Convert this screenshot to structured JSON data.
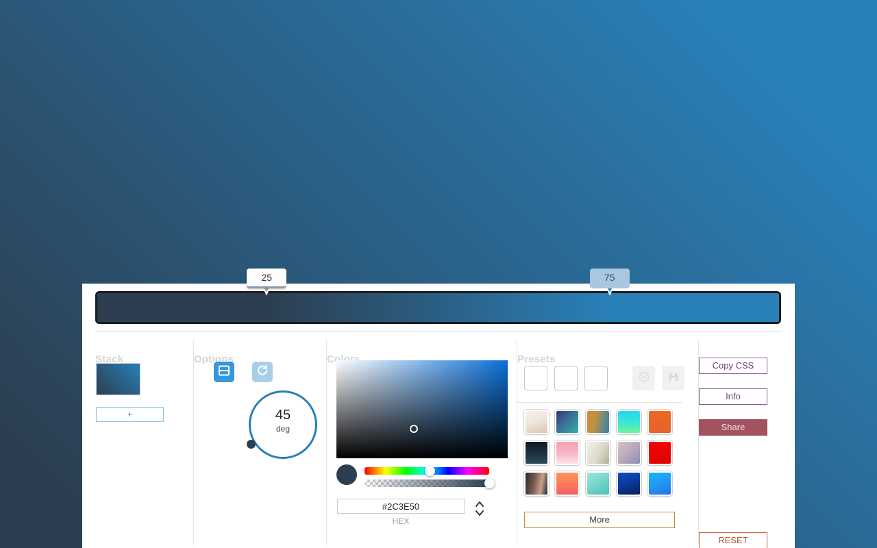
{
  "background": {
    "type": "linear-gradient",
    "angle_deg": 45,
    "from": "#2C3E50",
    "to": "#2980B9"
  },
  "preview": {
    "gradient_css": "linear-gradient(90deg, #2C3E50 25%, #2980B9 75%)",
    "stops": [
      {
        "label": "25",
        "position_pct": 25,
        "color": "#2C3E50",
        "selected": false
      },
      {
        "label": "75",
        "position_pct": 75,
        "color": "#2980B9",
        "selected": true
      }
    ]
  },
  "columns": {
    "stack": {
      "title": "Stack",
      "add_label": "+",
      "layers": [
        {
          "name": "layer-thumbnail",
          "gradient_css": "linear-gradient(45deg, #2C3E50, #2980B9)"
        }
      ]
    },
    "options": {
      "title": "Options",
      "linear_icon": "linear-gradient-icon",
      "radial_icon": "refresh-rotate-icon",
      "linear_active": true,
      "angle_value": "45",
      "angle_unit": "deg"
    },
    "colors": {
      "title": "Colors",
      "picker_color": "#0a6fd8",
      "current_swatch": "#2C3E50",
      "hue_pct": 52,
      "alpha_pct": 100,
      "hex_value": "#2C3E50",
      "hex_label": "HEX",
      "stepper_icon": "chevron-up-down-icon"
    },
    "presets": {
      "title": "Presets",
      "saved_slots": [
        "",
        "",
        ""
      ],
      "saved_actions": [
        {
          "icon": "check-circle-icon",
          "disabled": true
        },
        {
          "icon": "floppy-save-icon",
          "disabled": true
        }
      ],
      "more_label": "More",
      "swatches": [
        {
          "gradient_css": "linear-gradient(160deg, #f7f3ee 0%, #efe6dc 45%, #d8c6b6 100%)"
        },
        {
          "gradient_css": "linear-gradient(135deg, #2b3b73 0%, #3b6f96 45%, #2fb3ab 100%)"
        },
        {
          "gradient_css": "linear-gradient(100deg, #c98b3c 0%, #c2933f 35%, #2f7fb0 100%)"
        },
        {
          "gradient_css": "linear-gradient(180deg, #22d7f5 0%, #43e8ce 60%, #72f59a 100%)"
        },
        {
          "gradient_css": "linear-gradient(180deg, #ed6a24 0%, #e8622a 100%)"
        },
        {
          "gradient_css": "linear-gradient(180deg, #0d1a26 0%, #1c3140 55%, #2f4d5c 100%)"
        },
        {
          "gradient_css": "linear-gradient(180deg, #f4a0b4 0%, #f7b8c6 55%, #fde3e8 100%)"
        },
        {
          "gradient_css": "linear-gradient(120deg, #f2f0ea 0%, #ddd9cc 55%, #b3ae97 100%)"
        },
        {
          "gradient_css": "linear-gradient(135deg, #d8c2bc 0%, #b8a9bd 50%, #8d8bb5 100%)"
        },
        {
          "gradient_css": "linear-gradient(180deg, #f00505 0%, #e00303 100%)"
        },
        {
          "gradient_css": "linear-gradient(100deg, #2b2b2b 0%, #7a5a50 40%, #c9a08a 70%, #1b2a38 100%)"
        },
        {
          "gradient_css": "linear-gradient(180deg, #ff9358 0%, #fb7a5c 55%, #f4615f 100%)"
        },
        {
          "gradient_css": "linear-gradient(150deg, #9fe3da 0%, #6fd3c7 55%, #49c2b6 100%)"
        },
        {
          "gradient_css": "linear-gradient(160deg, #0b4dc4 0%, #0b3aa0 45%, #071f5c 100%)"
        },
        {
          "gradient_css": "linear-gradient(160deg, #17b5f7 0%, #2196f3 55%, #2b6fe0 100%)"
        }
      ]
    },
    "actions": {
      "copy_css_label": "Copy CSS",
      "info_label": "Info",
      "share_label": "Share",
      "reset_label": "RESET",
      "copy_css_color": "#6b3f73",
      "info_color": "#6b3f73",
      "share_color": "#a35260",
      "reset_color": "#b4512f"
    }
  }
}
